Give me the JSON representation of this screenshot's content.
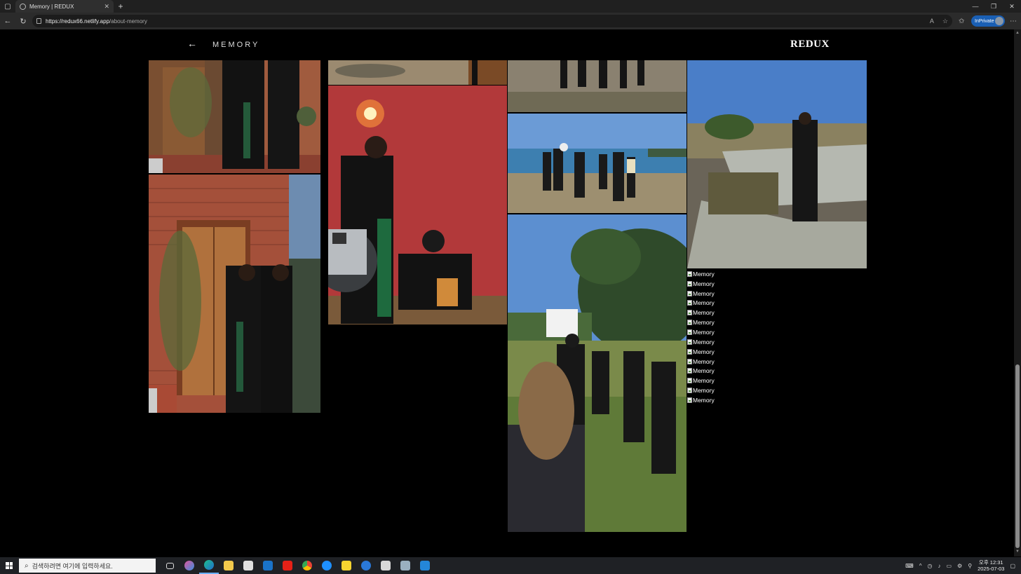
{
  "browser": {
    "tab_title": "Memory | REDUX",
    "tab_close": "✕",
    "new_tab": "+",
    "url_host": "https://redux66.netlify.app",
    "url_path": "/about-memory",
    "inprivate_label": "InPrivate",
    "window_controls": [
      "—",
      "❐",
      "✕"
    ]
  },
  "site": {
    "back_arrow": "←",
    "page_title": "MEMORY",
    "brand": "REDUX"
  },
  "gallery": {
    "broken_image_alt": "Memory",
    "broken_image_count": 14,
    "photos": [
      {
        "name": "photo-doorway-couple-top",
        "desc": "couple at wooden door, cropped top"
      },
      {
        "name": "photo-doorway-couple",
        "desc": "couple at brick wall wooden door"
      },
      {
        "name": "photo-floor-puddle",
        "desc": "floor with puddle, cropped top"
      },
      {
        "name": "photo-red-wall-models",
        "desc": "models posing against red wall with lamp"
      },
      {
        "name": "photo-crew-on-rocks",
        "desc": "crew standing on rocks"
      },
      {
        "name": "photo-beach-crew",
        "desc": "film crew on the beach"
      },
      {
        "name": "photo-pine-tree-crew",
        "desc": "crew under pine tree in grass field"
      },
      {
        "name": "photo-model-on-concrete",
        "desc": "model standing on concrete tank"
      }
    ]
  },
  "taskbar": {
    "search_placeholder": "검색하려면 여기에 입력하세요.",
    "time": "오후 12:31",
    "date": "2025-07-03",
    "apps": [
      "task-view",
      "copilot",
      "edge",
      "file-explorer",
      "store",
      "outlook",
      "youtube",
      "chrome",
      "internet-explorer",
      "sticky-notes",
      "app-blue",
      "app-gray",
      "app-gray-2",
      "vscode"
    ]
  },
  "colors": {
    "page_bg": "#000000",
    "inprivate_badge": "#1a5fb4"
  }
}
